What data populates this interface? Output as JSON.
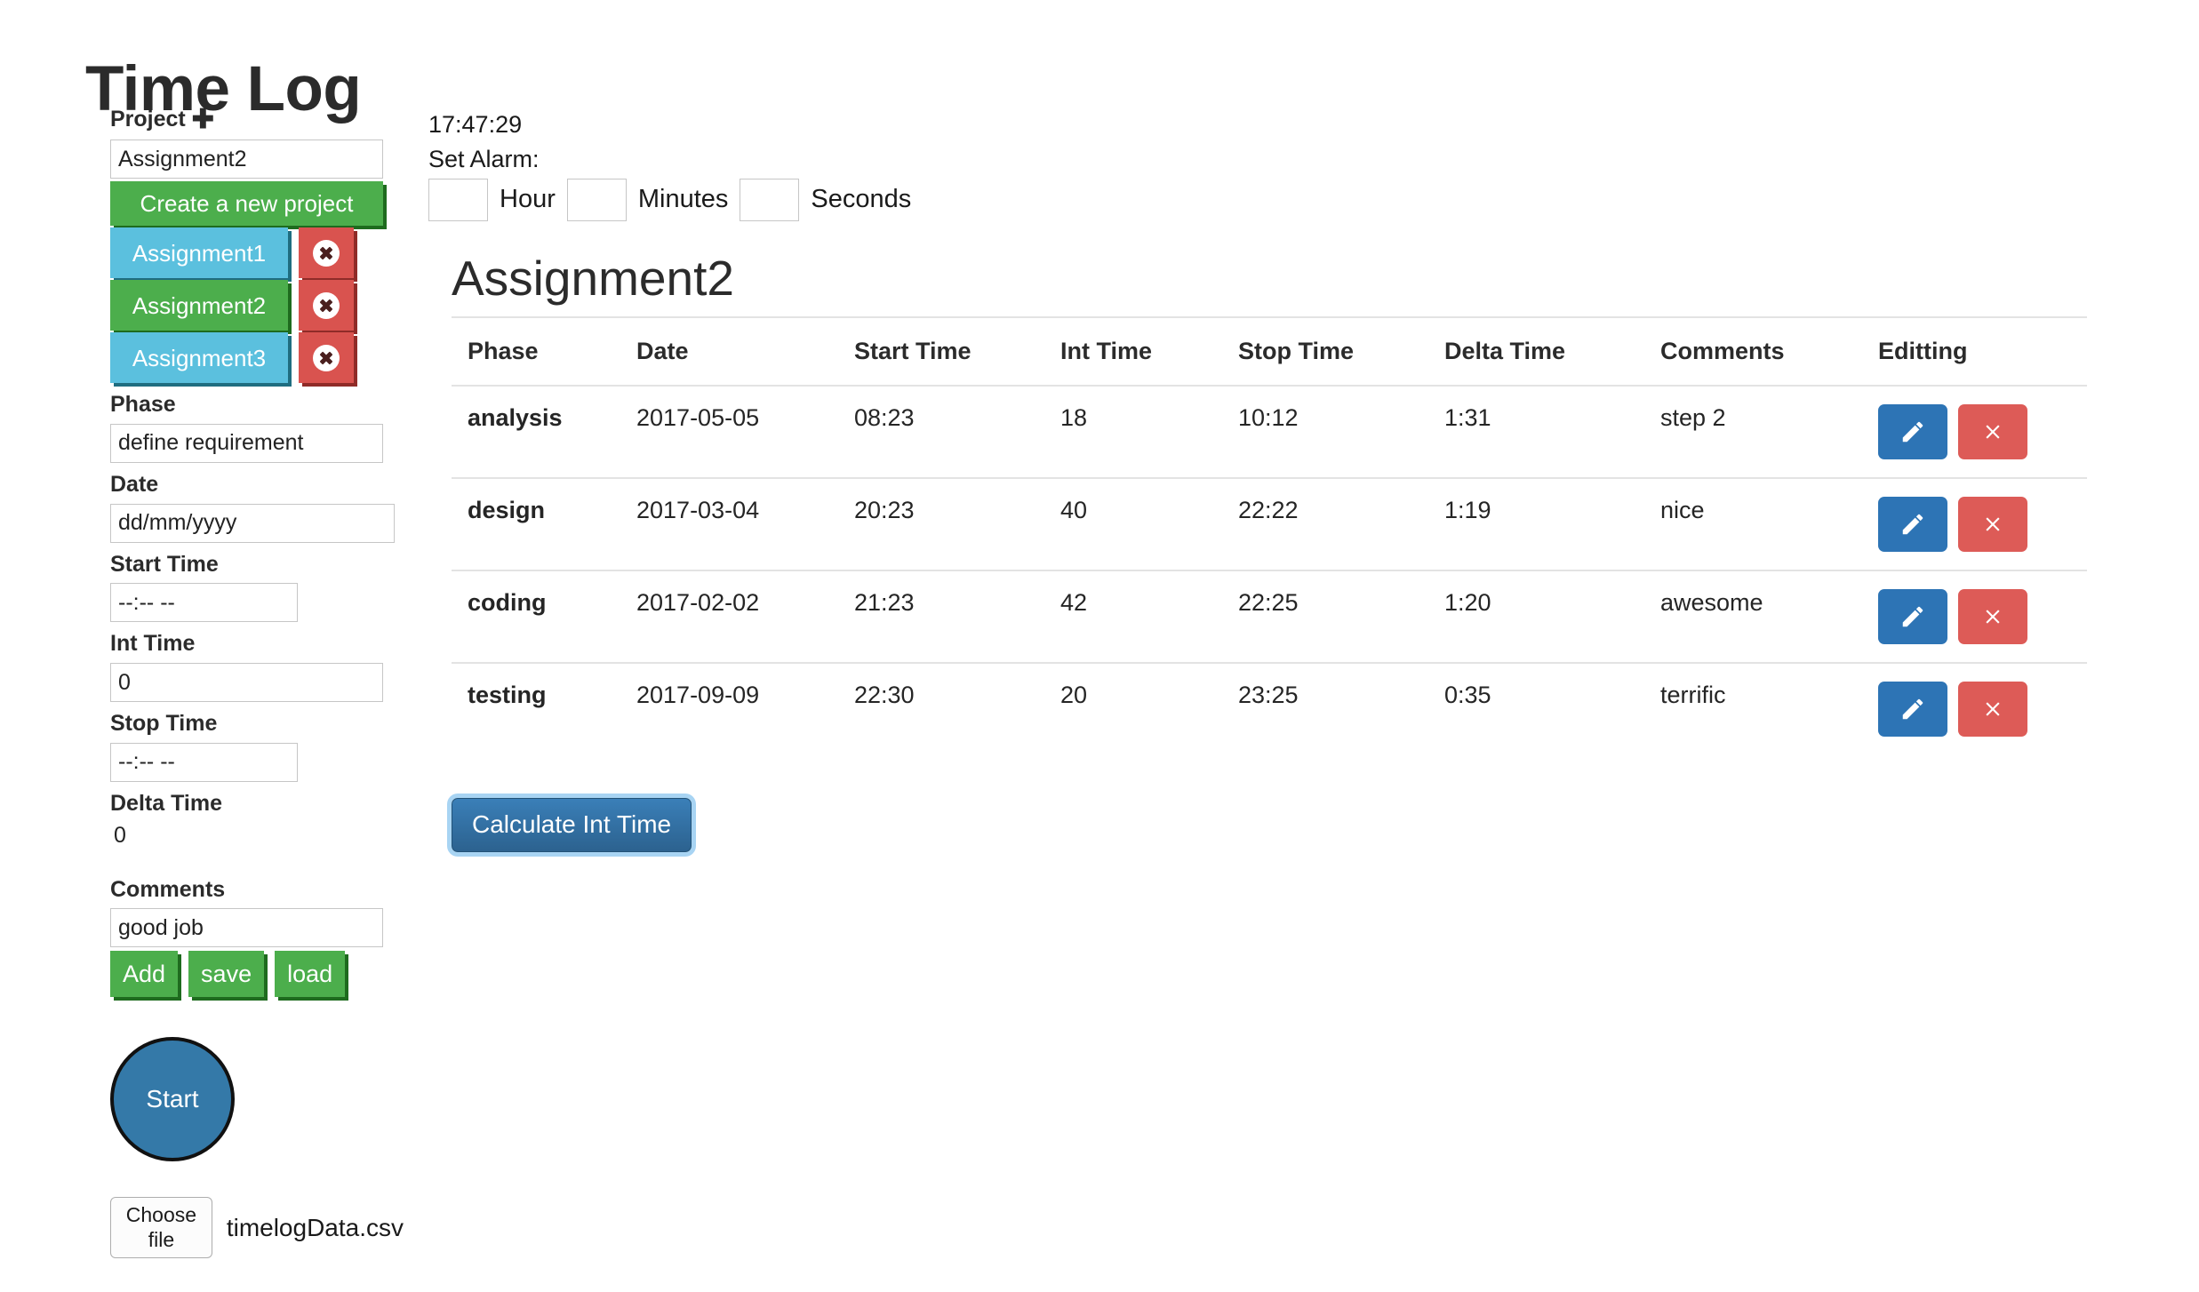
{
  "app": {
    "title": "Time Log"
  },
  "sidebar": {
    "project_label": "Project",
    "project_add_icon": "plus-icon",
    "project_input_value": "Assignment2",
    "create_project_label": "Create a new project",
    "projects": [
      {
        "name": "Assignment1",
        "selected": false,
        "delete_icon": "close-circle-icon"
      },
      {
        "name": "Assignment2",
        "selected": true,
        "delete_icon": "close-circle-icon"
      },
      {
        "name": "Assignment3",
        "selected": false,
        "delete_icon": "close-circle-icon"
      }
    ],
    "phase_label": "Phase",
    "phase_value": "define requirement",
    "date_label": "Date",
    "date_placeholder": "dd/mm/yyyy",
    "start_time_label": "Start Time",
    "start_time_placeholder": "--:-- --",
    "int_time_label": "Int Time",
    "int_time_value": "0",
    "stop_time_label": "Stop Time",
    "stop_time_placeholder": "--:-- --",
    "delta_time_label": "Delta Time",
    "delta_time_value": "0",
    "comments_label": "Comments",
    "comments_value": "good job",
    "add_label": "Add",
    "save_label": "save",
    "load_label": "load",
    "start_label": "Start",
    "choose_file_label": "Choose file",
    "file_name": "timelogData.csv"
  },
  "clock": {
    "current_time": "17:47:29",
    "alarm_label": "Set Alarm:",
    "hour_value": "",
    "hour_unit": "Hour",
    "minutes_value": "",
    "minutes_unit": "Minutes",
    "seconds_value": "",
    "seconds_unit": "Seconds"
  },
  "main": {
    "heading": "Assignment2",
    "calculate_label": "Calculate Int Time",
    "table": {
      "columns": [
        "Phase",
        "Date",
        "Start Time",
        "Int Time",
        "Stop Time",
        "Delta Time",
        "Comments",
        "Editting"
      ],
      "rows": [
        {
          "phase": "analysis",
          "date": "2017-05-05",
          "start_time": "08:23",
          "int_time": "18",
          "stop_time": "10:12",
          "delta_time": "1:31",
          "comments": "step 2",
          "edit_icon": "pencil-icon",
          "delete_icon": "close-x-icon"
        },
        {
          "phase": "design",
          "date": "2017-03-04",
          "start_time": "20:23",
          "int_time": "40",
          "stop_time": "22:22",
          "delta_time": "1:19",
          "comments": "nice",
          "edit_icon": "pencil-icon",
          "delete_icon": "close-x-icon"
        },
        {
          "phase": "coding",
          "date": "2017-02-02",
          "start_time": "21:23",
          "int_time": "42",
          "stop_time": "22:25",
          "delta_time": "1:20",
          "comments": "awesome",
          "edit_icon": "pencil-icon",
          "delete_icon": "close-x-icon"
        },
        {
          "phase": "testing",
          "date": "2017-09-09",
          "start_time": "22:30",
          "int_time": "20",
          "stop_time": "23:25",
          "delta_time": "0:35",
          "comments": "terrific",
          "edit_icon": "pencil-icon",
          "delete_icon": "close-x-icon"
        }
      ]
    }
  },
  "colors": {
    "green": "#4cae4c",
    "info_blue": "#5bc0de",
    "danger_red": "#d9534f",
    "primary_blue": "#2d74b5",
    "start_blue": "#3479a8",
    "table_border": "#e3e3e3"
  }
}
